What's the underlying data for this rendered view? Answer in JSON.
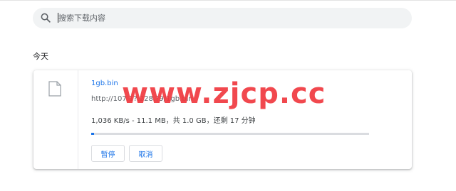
{
  "search": {
    "placeholder": "搜索下载内容",
    "icon": "search-icon"
  },
  "section": {
    "title": "今天"
  },
  "download": {
    "file_icon": "file-icon",
    "file_name": "1gb.bin",
    "url": "http://107.1?.228.?9/1gb.bin",
    "status": "1,036 KB/s - 11.1 MB，共 1.0 GB，还剩 17 分钟",
    "progress_fraction": 0.011,
    "pause_label": "暂停",
    "cancel_label": "取消"
  },
  "watermark": {
    "text": "www.zjcp.cc"
  },
  "colors": {
    "accent": "#1a73e8",
    "watermark": "#f0393f",
    "search_bg": "#f1f3f4"
  }
}
